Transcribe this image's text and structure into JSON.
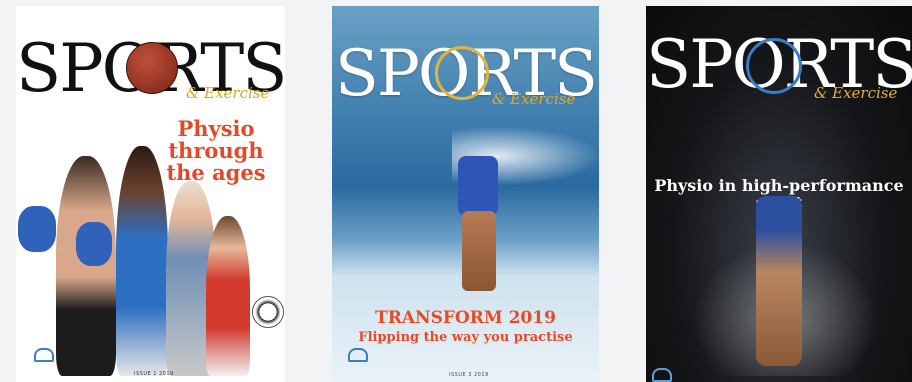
{
  "covers": [
    {
      "masthead": "SPORTS",
      "subtitle": "& Exercise",
      "headline": "Physio through the ages",
      "issue": "ISSUE 1 2019",
      "colors": {
        "accent": "#e04a2a",
        "subtitle": "#d9a51e"
      }
    },
    {
      "masthead": "SPORTS",
      "subtitle": "& Exercise",
      "headline": "TRANSFORM 2019",
      "tagline": "Flipping the way you practise",
      "issue": "ISSUE 3 2019",
      "colors": {
        "accent": "#e84a26",
        "subtitle": "#e2a82a"
      }
    },
    {
      "masthead": "SPORTS",
      "subtitle": "& Exercise",
      "headline": "Physio in high-performance sport",
      "colors": {
        "accent": "#ffffff",
        "subtitle": "#e0b040"
      }
    }
  ],
  "icons": [
    "basketball-icon",
    "boxing-glove-icon",
    "soccer-ball-icon",
    "apa-logo-icon"
  ]
}
